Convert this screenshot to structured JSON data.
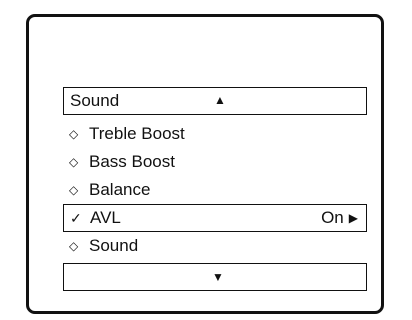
{
  "menu": {
    "title": "Sound",
    "up_icon": "up-arrow-icon",
    "down_icon": "down-arrow-icon",
    "items": [
      {
        "label": "Treble Boost",
        "marker": "◇",
        "marker_icon": "diamond-icon",
        "selected": false
      },
      {
        "label": "Bass Boost",
        "marker": "◇",
        "marker_icon": "diamond-icon",
        "selected": false
      },
      {
        "label": "Balance",
        "marker": "◇",
        "marker_icon": "diamond-icon",
        "selected": false
      },
      {
        "label": "AVL",
        "marker": "✓",
        "marker_icon": "checkmark-icon",
        "selected": true,
        "value": "On",
        "value_icon": "right-arrow-icon"
      },
      {
        "label": "Sound",
        "marker": "◇",
        "marker_icon": "diamond-icon",
        "selected": false
      }
    ]
  },
  "colors": {
    "foreground": "#111111",
    "background": "#ffffff"
  }
}
